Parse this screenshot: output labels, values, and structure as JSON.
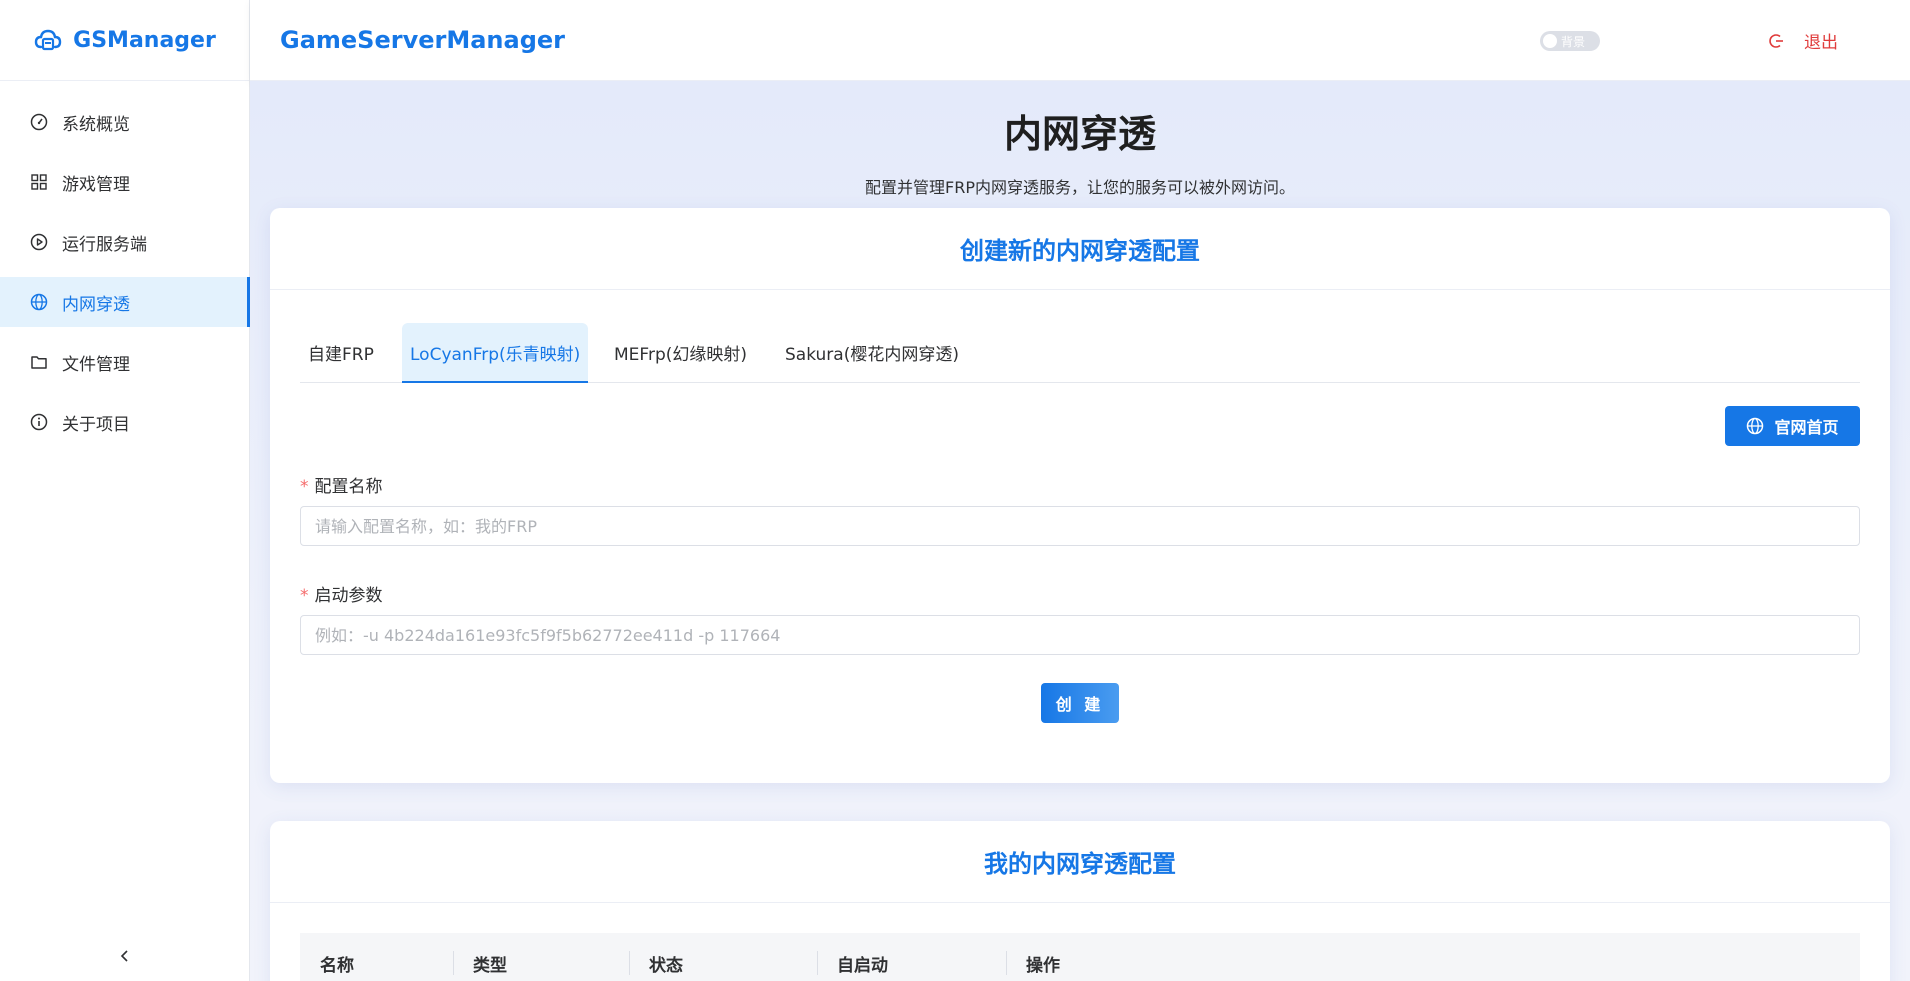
{
  "app": {
    "logo_text": "GSManager",
    "header_title": "GameServerManager"
  },
  "colors": {
    "primary": "#1677e6",
    "danger": "#e03c3c",
    "active_bg": "#e3f2fd"
  },
  "sidebar": {
    "items": [
      {
        "label": "系统概览",
        "icon": "dashboard-icon"
      },
      {
        "label": "游戏管理",
        "icon": "grid-icon"
      },
      {
        "label": "运行服务端",
        "icon": "play-circle-icon"
      },
      {
        "label": "内网穿透",
        "icon": "globe-icon",
        "active": true
      },
      {
        "label": "文件管理",
        "icon": "folder-icon"
      },
      {
        "label": "关于项目",
        "icon": "info-icon"
      }
    ],
    "collapse_icon": "chevron-left-icon"
  },
  "header": {
    "bg_toggle_label": "背景",
    "logout_label": "退出"
  },
  "page": {
    "title": "内网穿透",
    "subtitle": "配置并管理FRP内网穿透服务，让您的服务可以被外网访问。"
  },
  "create_card": {
    "title": "创建新的内网穿透配置",
    "tabs": [
      {
        "label": "自建FRP"
      },
      {
        "label": "LoCyanFrp(乐青映射)",
        "active": true
      },
      {
        "label": "MEFrp(幻缘映射)"
      },
      {
        "label": "Sakura(樱花内网穿透)"
      }
    ],
    "site_button": "官网首页",
    "name_label": "配置名称",
    "name_placeholder": "请输入配置名称，如：我的FRP",
    "params_label": "启动参数",
    "params_placeholder": "例如：-u 4b224da161e93fc5f9f5b62772ee411d -p 117664",
    "create_button": "创 建"
  },
  "list_card": {
    "title": "我的内网穿透配置",
    "columns": [
      "名称",
      "类型",
      "状态",
      "自启动",
      "操作"
    ]
  }
}
